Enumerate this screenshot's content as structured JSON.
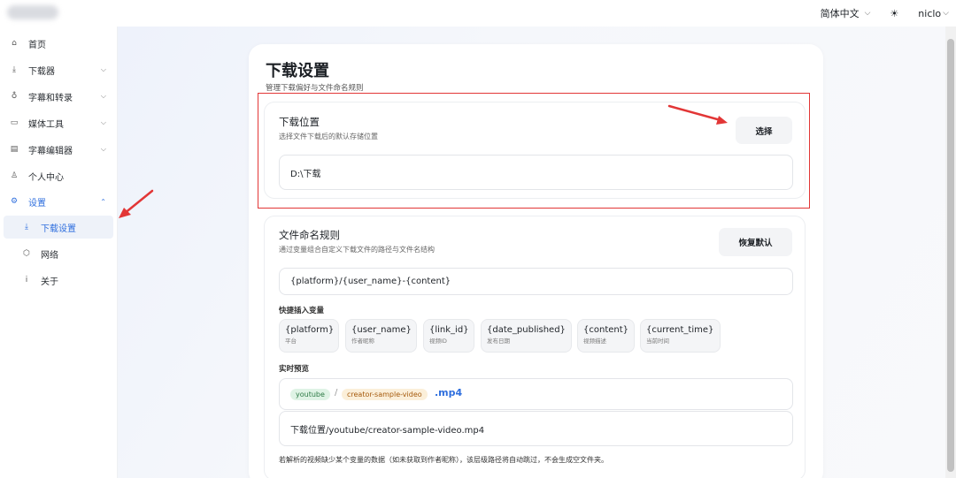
{
  "topbar": {
    "language": "简体中文",
    "theme_icon": "sun-icon",
    "user": "niclo"
  },
  "sidebar": {
    "items": [
      {
        "label": "首页",
        "icon": "home-icon"
      },
      {
        "label": "下载器",
        "icon": "download-icon"
      },
      {
        "label": "字幕和转录",
        "icon": "microphone-icon"
      },
      {
        "label": "媒体工具",
        "icon": "video-icon"
      },
      {
        "label": "字幕编辑器",
        "icon": "subtitle-icon"
      },
      {
        "label": "个人中心",
        "icon": "user-icon"
      },
      {
        "label": "设置",
        "icon": "gear-icon"
      },
      {
        "label": "下载设置",
        "icon": "download-icon"
      },
      {
        "label": "网络",
        "icon": "network-icon"
      },
      {
        "label": "关于",
        "icon": "info-icon"
      }
    ]
  },
  "page": {
    "title": "下载设置",
    "subtitle": "管理下载偏好与文件命名规则"
  },
  "download_location": {
    "title": "下载位置",
    "subtitle": "选择文件下载后的默认存储位置",
    "button": "选择",
    "path": "D:\\下载"
  },
  "naming": {
    "title": "文件命名规则",
    "subtitle": "通过变量组合自定义下载文件的路径与文件名结构",
    "reset_button": "恢复默认",
    "pattern": "{platform}/{user_name}-{content}",
    "vars_label": "快捷插入变量",
    "vars": [
      {
        "name": "{platform}",
        "desc": "平台"
      },
      {
        "name": "{user_name}",
        "desc": "作者昵称"
      },
      {
        "name": "{link_id}",
        "desc": "视频ID"
      },
      {
        "name": "{date_published}",
        "desc": "发布日期"
      },
      {
        "name": "{content}",
        "desc": "视频描述"
      },
      {
        "name": "{current_time}",
        "desc": "当前时间"
      }
    ],
    "preview_label": "实时预览",
    "preview": {
      "platform": "youtube",
      "separator": "/",
      "filename": "creator-sample-video",
      "ext": ".mp4"
    },
    "full_path": "下载位置/youtube/creator-sample-video.mp4",
    "note": "若解析的视频缺少某个变量的数据（如未获取到作者昵称），该层级路径将自动跳过，不会生成空文件夹。"
  },
  "colors": {
    "accent": "#2f6fde",
    "highlight_red": "#e23636"
  }
}
